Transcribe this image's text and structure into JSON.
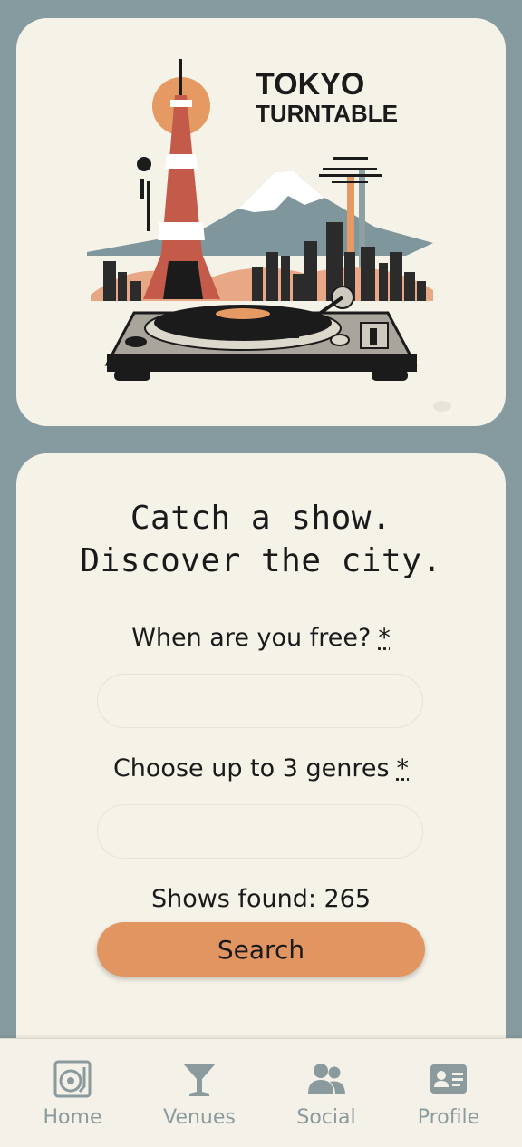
{
  "hero": {
    "logo_line1": "TOKYO",
    "logo_line2": "TURNTABLE"
  },
  "form": {
    "headline_line1": "Catch a show.",
    "headline_line2": "Discover the city.",
    "date_label": "When are you free?",
    "date_required": "*",
    "date_value": "",
    "genres_label": "Choose up to 3 genres",
    "genres_required": "*",
    "genres_value": "",
    "shows_found": "Shows found: 265",
    "search_label": "Search"
  },
  "nav": {
    "items": [
      {
        "label": "Home",
        "icon": "turntable-icon"
      },
      {
        "label": "Venues",
        "icon": "cocktail-icon"
      },
      {
        "label": "Social",
        "icon": "people-icon"
      },
      {
        "label": "Profile",
        "icon": "id-card-icon"
      }
    ]
  },
  "colors": {
    "background": "#859b9f",
    "card": "#f5f2e8",
    "accent": "#e19561",
    "nav_icon": "#8a9a9d"
  }
}
